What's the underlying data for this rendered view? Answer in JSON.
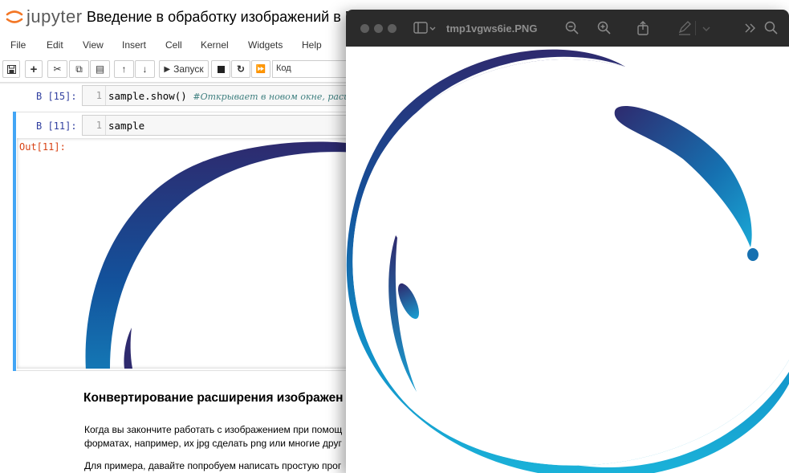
{
  "jupyter": {
    "logo_text": "jupyter",
    "notebook_title": "Введение в обработку изображений в Pyt",
    "menu": [
      "File",
      "Edit",
      "View",
      "Insert",
      "Cell",
      "Kernel",
      "Widgets",
      "Help"
    ],
    "toolbar": {
      "run_label": "Запуск",
      "cell_type": "Код"
    },
    "cells": [
      {
        "prompt": "В [15]:",
        "line": "1",
        "code": "sample.show()",
        "comment": "#Открывает в новом окне, расши"
      },
      {
        "prompt": "В [11]:",
        "line": "1",
        "code": "sample",
        "out_prompt": "Out[11]:"
      }
    ],
    "markdown": {
      "heading": "Конвертирование расширения изображен",
      "para1_line1": "Когда вы закончите работать с изображением при помощ",
      "para1_line2": "форматах, например, их jpg сделать png или многие друг",
      "para2_line1": "Для примера, давайте попробуем написать простую прог"
    }
  },
  "preview": {
    "filename": "tmp1vgws6ie.PNG",
    "icons": [
      "sidebar-icon",
      "zoom-out-icon",
      "zoom-in-icon",
      "share-icon",
      "markup-icon",
      "more-icon",
      "search-icon"
    ]
  },
  "colors": {
    "ring_dark": "#2e2a6e",
    "ring_light": "#1bb3d9",
    "selected_cell": "#42a5f5",
    "prompt_in": "#303f9f",
    "prompt_out": "#d84315"
  }
}
